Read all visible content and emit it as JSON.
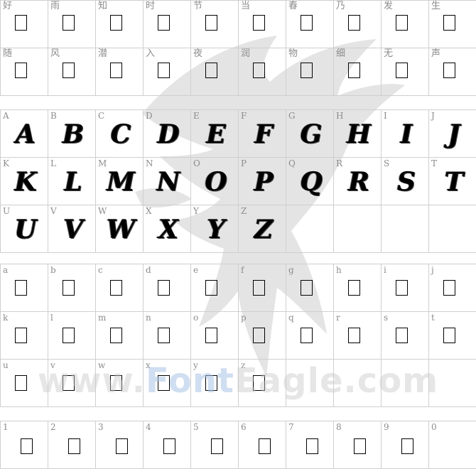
{
  "cjk_row": {
    "labels_1": [
      "好",
      "雨",
      "知",
      "时",
      "节",
      "当",
      "春",
      "乃",
      "发",
      "生"
    ],
    "labels_2": [
      "随",
      "风",
      "潜",
      "入",
      "夜",
      "润",
      "物",
      "细",
      "无",
      "声"
    ]
  },
  "uppercase": {
    "labels": [
      "A",
      "B",
      "C",
      "D",
      "E",
      "F",
      "G",
      "H",
      "I",
      "J",
      "K",
      "L",
      "M",
      "N",
      "O",
      "P",
      "Q",
      "R",
      "S",
      "T",
      "U",
      "V",
      "W",
      "X",
      "Y",
      "Z"
    ],
    "glyphs": [
      "A",
      "B",
      "C",
      "D",
      "E",
      "F",
      "G",
      "H",
      "I",
      "J",
      "K",
      "L",
      "M",
      "N",
      "O",
      "P",
      "Q",
      "R",
      "S",
      "T",
      "U",
      "V",
      "W",
      "X",
      "Y",
      "Z"
    ]
  },
  "lowercase": {
    "labels": [
      "a",
      "b",
      "c",
      "d",
      "e",
      "f",
      "g",
      "h",
      "i",
      "j",
      "k",
      "l",
      "m",
      "n",
      "o",
      "p",
      "q",
      "r",
      "s",
      "t",
      "u",
      "v",
      "w",
      "x",
      "y",
      "z"
    ]
  },
  "digits": {
    "labels": [
      "1",
      "2",
      "3",
      "4",
      "5",
      "6",
      "7",
      "8",
      "9",
      "0"
    ]
  },
  "watermark": {
    "part1": "www.",
    "part2": "Font",
    "part3": "Eagle.com"
  },
  "colors": {
    "grid_border": "#cfcfcf",
    "label": "#8c8c8c",
    "glyph": "#000000",
    "watermark": "#c8c8c8"
  }
}
